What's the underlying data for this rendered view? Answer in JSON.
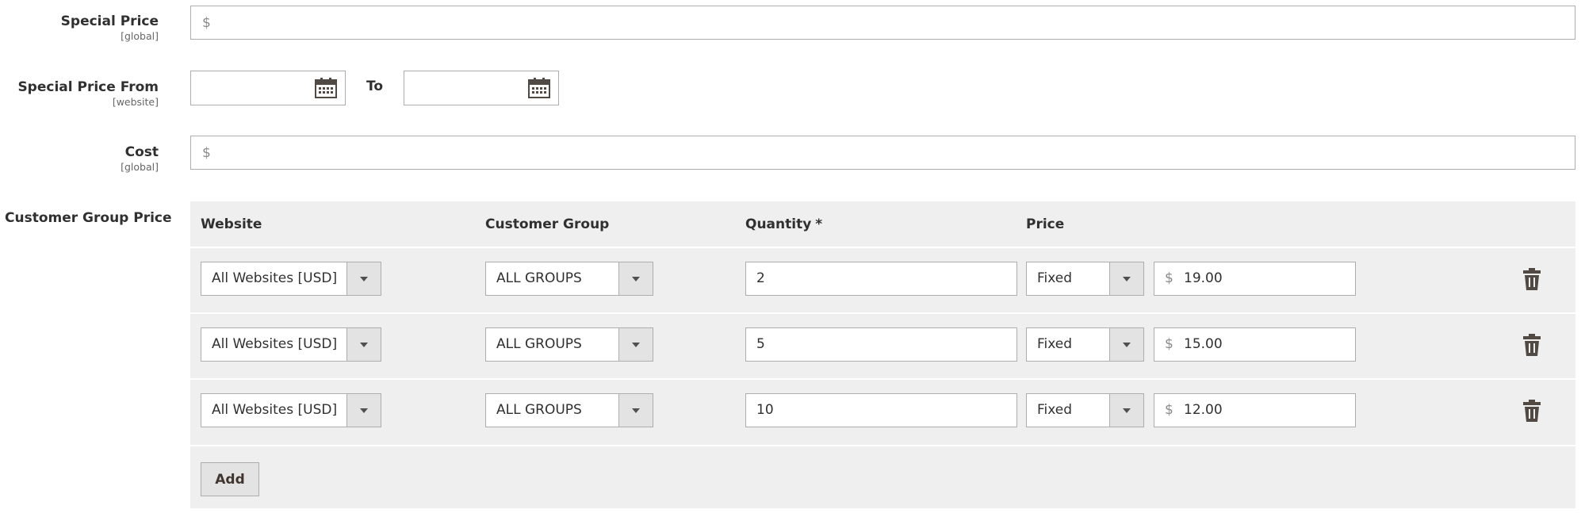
{
  "special_price": {
    "label": "Special Price",
    "scope": "[global]",
    "prefix": "$",
    "value": ""
  },
  "special_price_from": {
    "label": "Special Price From",
    "scope": "[website]",
    "from_value": "",
    "to_label": "To",
    "to_value": ""
  },
  "cost": {
    "label": "Cost",
    "scope": "[global]",
    "prefix": "$",
    "value": ""
  },
  "customer_group_price": {
    "label": "Customer Group Price",
    "headers": {
      "website": "Website",
      "customer_group": "Customer Group",
      "quantity": "Quantity",
      "required_mark": "*",
      "price": "Price"
    },
    "rows": [
      {
        "website": "All Websites [USD]",
        "group": "ALL GROUPS",
        "quantity": "2",
        "price_type": "Fixed",
        "currency": "$",
        "price": "19.00"
      },
      {
        "website": "All Websites [USD]",
        "group": "ALL GROUPS",
        "quantity": "5",
        "price_type": "Fixed",
        "currency": "$",
        "price": "15.00"
      },
      {
        "website": "All Websites [USD]",
        "group": "ALL GROUPS",
        "quantity": "10",
        "price_type": "Fixed",
        "currency": "$",
        "price": "12.00"
      }
    ],
    "add_label": "Add"
  },
  "icons": {
    "calendar": "calendar-icon",
    "delete": "trash-icon",
    "dropdown": "chevron-down-icon"
  }
}
